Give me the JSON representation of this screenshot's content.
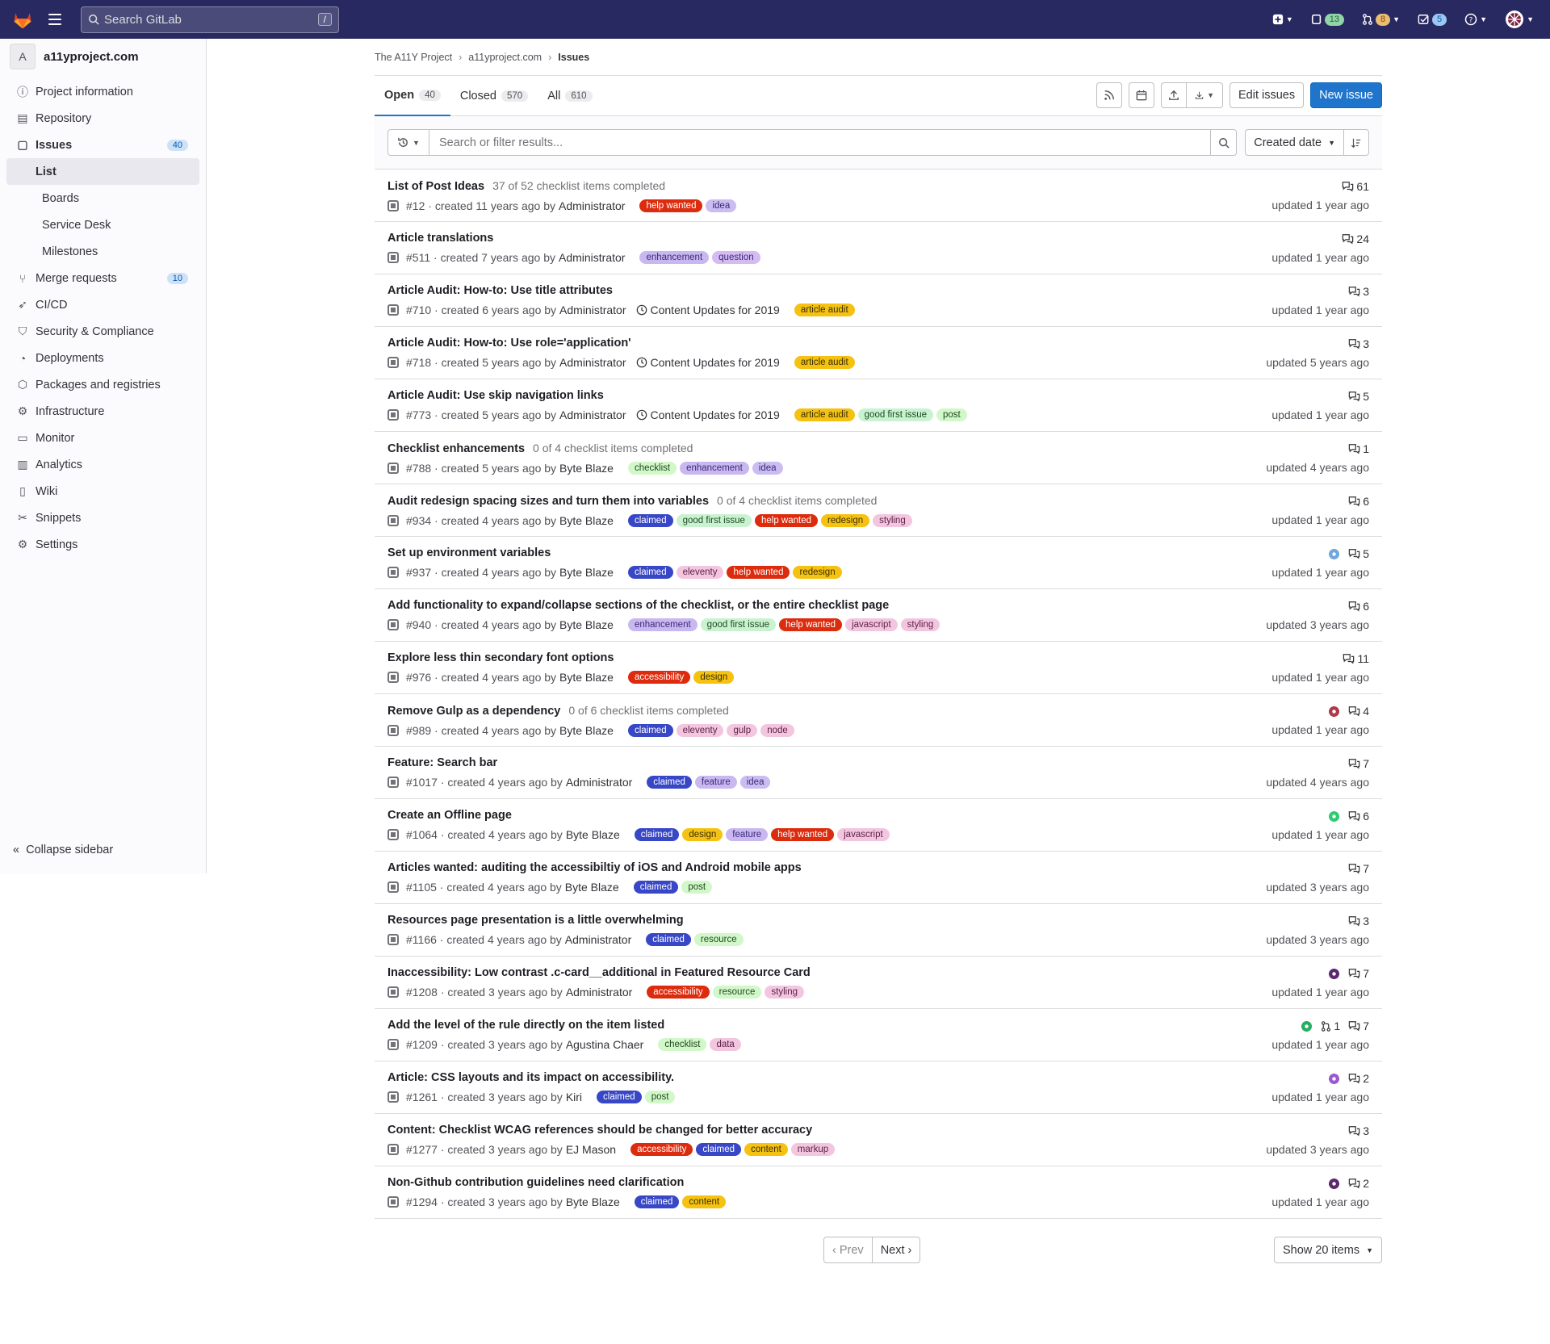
{
  "topbar": {
    "search_placeholder": "Search GitLab",
    "search_shortcut": "/",
    "issues_count": "13",
    "mr_count": "8",
    "todo_count": "5"
  },
  "sidebar": {
    "project_initial": "A",
    "project_name": "a11yproject.com",
    "items": [
      {
        "label": "Project information",
        "icon": "info-icon"
      },
      {
        "label": "Repository",
        "icon": "doc-icon"
      },
      {
        "label": "Issues",
        "icon": "issues-icon",
        "count": "40"
      },
      {
        "label": "Merge requests",
        "icon": "merge-request-icon",
        "count": "10"
      },
      {
        "label": "CI/CD",
        "icon": "rocket-icon"
      },
      {
        "label": "Security & Compliance",
        "icon": "shield-icon"
      },
      {
        "label": "Deployments",
        "icon": "deployments-icon"
      },
      {
        "label": "Packages and registries",
        "icon": "package-icon"
      },
      {
        "label": "Infrastructure",
        "icon": "cloud-icon"
      },
      {
        "label": "Monitor",
        "icon": "monitor-icon"
      },
      {
        "label": "Analytics",
        "icon": "chart-icon"
      },
      {
        "label": "Wiki",
        "icon": "book-icon"
      },
      {
        "label": "Snippets",
        "icon": "scissors-icon"
      },
      {
        "label": "Settings",
        "icon": "gear-icon"
      }
    ],
    "issues_sub": [
      "List",
      "Boards",
      "Service Desk",
      "Milestones"
    ],
    "collapse_label": "Collapse sidebar"
  },
  "breadcrumb": [
    "The A11Y Project",
    "a11yproject.com",
    "Issues"
  ],
  "tabs": [
    {
      "label": "Open",
      "count": "40"
    },
    {
      "label": "Closed",
      "count": "570"
    },
    {
      "label": "All",
      "count": "610"
    }
  ],
  "actions": {
    "edit_issues": "Edit issues",
    "new_issue": "New issue"
  },
  "filter": {
    "placeholder": "Search or filter results...",
    "sort_label": "Created date"
  },
  "label_colors": {
    "help wanted": [
      "#dd2b0e",
      "#fff"
    ],
    "idea": [
      "#cbbcf2",
      "#3a2a78"
    ],
    "enhancement": [
      "#c9b8f0",
      "#3a2a78"
    ],
    "question": [
      "#d4bbf2",
      "#3a2a78"
    ],
    "article audit": [
      "#f5c211",
      "#3b2f00"
    ],
    "good first issue": [
      "#c9f2d0",
      "#1e4a20"
    ],
    "post": [
      "#d2f7c8",
      "#1e4a20"
    ],
    "checklist": [
      "#d2f7c8",
      "#1e4a20"
    ],
    "claimed": [
      "#3847c6",
      "#fff"
    ],
    "redesign": [
      "#f5c211",
      "#3b2f00"
    ],
    "styling": [
      "#f3c6e0",
      "#5c1e44"
    ],
    "eleventy": [
      "#f3c6e0",
      "#5c1e44"
    ],
    "javascript": [
      "#f3c6e0",
      "#5c1e44"
    ],
    "accessibility": [
      "#dd2b0e",
      "#fff"
    ],
    "design": [
      "#f5c211",
      "#3b2f00"
    ],
    "gulp": [
      "#f3c6e0",
      "#5c1e44"
    ],
    "node": [
      "#f3c6e0",
      "#5c1e44"
    ],
    "feature": [
      "#c9b8f0",
      "#3a2a78"
    ],
    "resource": [
      "#d2f7c8",
      "#1e4a20"
    ],
    "data": [
      "#f3c6e0",
      "#5c1e44"
    ],
    "content": [
      "#f5c211",
      "#3b2f00"
    ],
    "markup": [
      "#f3c6e0",
      "#5c1e44"
    ]
  },
  "issues": [
    {
      "title": "List of Post Ideas",
      "tasks": "37 of 52 checklist items completed",
      "ref": "#12",
      "created": "created 11 years ago by",
      "author": "Administrator",
      "labels": [
        "help wanted",
        "idea"
      ],
      "comments": "61",
      "updated": "updated 1 year ago"
    },
    {
      "title": "Article translations",
      "ref": "#511",
      "created": "created 7 years ago by",
      "author": "Administrator",
      "labels": [
        "enhancement",
        "question"
      ],
      "comments": "24",
      "updated": "updated 1 year ago"
    },
    {
      "title": "Article Audit: How-to: Use title attributes",
      "ref": "#710",
      "created": "created 6 years ago by",
      "author": "Administrator",
      "milestone": "Content Updates for 2019",
      "labels": [
        "article audit"
      ],
      "comments": "3",
      "updated": "updated 1 year ago"
    },
    {
      "title": "Article Audit: How-to: Use role='application'",
      "ref": "#718",
      "created": "created 5 years ago by",
      "author": "Administrator",
      "milestone": "Content Updates for 2019",
      "labels": [
        "article audit"
      ],
      "comments": "3",
      "updated": "updated 5 years ago"
    },
    {
      "title": "Article Audit: Use skip navigation links",
      "ref": "#773",
      "created": "created 5 years ago by",
      "author": "Administrator",
      "milestone": "Content Updates for 2019",
      "labels": [
        "article audit",
        "good first issue",
        "post"
      ],
      "comments": "5",
      "updated": "updated 1 year ago"
    },
    {
      "title": "Checklist enhancements",
      "tasks": "0 of 4 checklist items completed",
      "ref": "#788",
      "created": "created 5 years ago by",
      "author": "Byte Blaze",
      "labels": [
        "checklist",
        "enhancement",
        "idea"
      ],
      "comments": "1",
      "updated": "updated 4 years ago"
    },
    {
      "title": "Audit redesign spacing sizes and turn them into variables",
      "tasks": "0 of 4 checklist items completed",
      "ref": "#934",
      "created": "created 4 years ago by",
      "author": "Byte Blaze",
      "labels": [
        "claimed",
        "good first issue",
        "help wanted",
        "redesign",
        "styling"
      ],
      "comments": "6",
      "updated": "updated 1 year ago"
    },
    {
      "title": "Set up environment variables",
      "ref": "#937",
      "created": "created 4 years ago by",
      "author": "Byte Blaze",
      "labels": [
        "claimed",
        "eleventy",
        "help wanted",
        "redesign"
      ],
      "assignee": "#6fa8dc",
      "comments": "5",
      "updated": "updated 1 year ago"
    },
    {
      "title": "Add functionality to expand/collapse sections of the checklist, or the entire checklist page",
      "ref": "#940",
      "created": "created 4 years ago by",
      "author": "Byte Blaze",
      "labels": [
        "enhancement",
        "good first issue",
        "help wanted",
        "javascript",
        "styling"
      ],
      "comments": "6",
      "updated": "updated 3 years ago"
    },
    {
      "title": "Explore less thin secondary font options",
      "ref": "#976",
      "created": "created 4 years ago by",
      "author": "Byte Blaze",
      "labels": [
        "accessibility",
        "design"
      ],
      "comments": "11",
      "updated": "updated 1 year ago"
    },
    {
      "title": "Remove Gulp as a dependency",
      "tasks": "0 of 6 checklist items completed",
      "ref": "#989",
      "created": "created 4 years ago by",
      "author": "Byte Blaze",
      "labels": [
        "claimed",
        "eleventy",
        "gulp",
        "node"
      ],
      "assignee": "#b03a48",
      "comments": "4",
      "updated": "updated 1 year ago"
    },
    {
      "title": "Feature: Search bar",
      "ref": "#1017",
      "created": "created 4 years ago by",
      "author": "Administrator",
      "labels": [
        "claimed",
        "feature",
        "idea"
      ],
      "comments": "7",
      "updated": "updated 4 years ago"
    },
    {
      "title": "Create an Offline page",
      "ref": "#1064",
      "created": "created 4 years ago by",
      "author": "Byte Blaze",
      "labels": [
        "claimed",
        "design",
        "feature",
        "help wanted",
        "javascript"
      ],
      "assignee": "#2ecc71",
      "comments": "6",
      "updated": "updated 1 year ago"
    },
    {
      "title": "Articles wanted: auditing the accessibiltiy of iOS and Android mobile apps",
      "ref": "#1105",
      "created": "created 4 years ago by",
      "author": "Byte Blaze",
      "labels": [
        "claimed",
        "post"
      ],
      "comments": "7",
      "updated": "updated 3 years ago"
    },
    {
      "title": "Resources page presentation is a little overwhelming",
      "ref": "#1166",
      "created": "created 4 years ago by",
      "author": "Administrator",
      "labels": [
        "claimed",
        "resource"
      ],
      "comments": "3",
      "updated": "updated 3 years ago"
    },
    {
      "title": "Inaccessibility: Low contrast .c-card__additional in Featured Resource Card",
      "ref": "#1208",
      "created": "created 3 years ago by",
      "author": "Administrator",
      "labels": [
        "accessibility",
        "resource",
        "styling"
      ],
      "assignee": "#5b2a6e",
      "comments": "7",
      "updated": "updated 1 year ago"
    },
    {
      "title": "Add the level of the rule directly on the item listed",
      "ref": "#1209",
      "created": "created 3 years ago by",
      "author": "Agustina Chaer",
      "labels": [
        "checklist",
        "data"
      ],
      "assignee": "#27ae60",
      "mrs": "1",
      "comments": "7",
      "updated": "updated 1 year ago"
    },
    {
      "title": "Article: CSS layouts and its impact on accessibility.",
      "ref": "#1261",
      "created": "created 3 years ago by",
      "author": "Kiri",
      "labels": [
        "claimed",
        "post"
      ],
      "assignee": "#9b59d0",
      "comments": "2",
      "updated": "updated 1 year ago"
    },
    {
      "title": "Content: Checklist WCAG references should be changed for better accuracy",
      "ref": "#1277",
      "created": "created 3 years ago by",
      "author": "EJ Mason",
      "labels": [
        "accessibility",
        "claimed",
        "content",
        "markup"
      ],
      "comments": "3",
      "updated": "updated 3 years ago"
    },
    {
      "title": "Non-Github contribution guidelines need clarification",
      "ref": "#1294",
      "created": "created 3 years ago by",
      "author": "Byte Blaze",
      "labels": [
        "claimed",
        "content"
      ],
      "assignee": "#5b2a6e",
      "comments": "2",
      "updated": "updated 1 year ago"
    }
  ],
  "pagination": {
    "prev": "Prev",
    "next": "Next",
    "per_page": "Show 20 items"
  }
}
